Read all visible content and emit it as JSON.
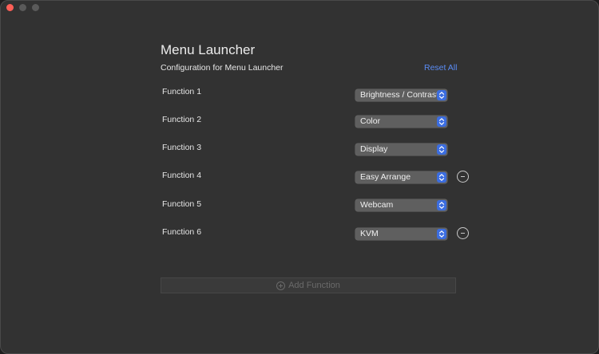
{
  "page": {
    "title": "Menu Launcher",
    "subtitle": "Configuration for Menu Launcher",
    "reset_label": "Reset All"
  },
  "functions": [
    {
      "label": "Function 1",
      "value": "Brightness / Contrast",
      "removable": false
    },
    {
      "label": "Function 2",
      "value": "Color",
      "removable": false
    },
    {
      "label": "Function 3",
      "value": "Display",
      "removable": false
    },
    {
      "label": "Function 4",
      "value": "Easy Arrange",
      "removable": true
    },
    {
      "label": "Function 5",
      "value": "Webcam",
      "removable": false
    },
    {
      "label": "Function 6",
      "value": "KVM",
      "removable": true
    }
  ],
  "add_button": {
    "label": "Add Function",
    "enabled": false
  },
  "colors": {
    "accent": "#3b6de0",
    "link": "#5a8cf5",
    "close": "#ff5f57"
  }
}
